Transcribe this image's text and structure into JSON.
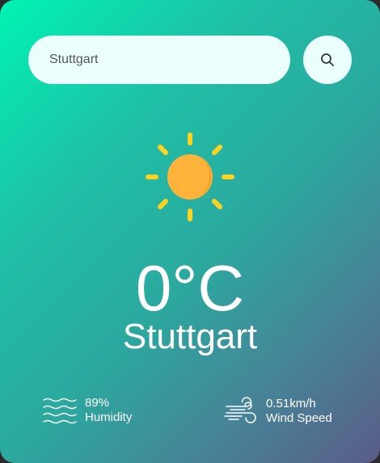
{
  "search": {
    "value": "Stuttgart",
    "placeholder": ""
  },
  "weather": {
    "icon": "sun-icon",
    "temperature": "0°C",
    "city": "Stuttgart"
  },
  "details": {
    "humidity": {
      "icon": "humidity-waves-icon",
      "value": "89%",
      "label": "Humidity"
    },
    "wind": {
      "icon": "wind-icon",
      "value": "0.51km/h",
      "label": "Wind Speed"
    }
  },
  "colors": {
    "gradient_start": "#00f3b4",
    "gradient_end": "#5a5c87",
    "search_bg": "#ebfffc",
    "sun_core": "#ffb33a",
    "sun_rays": "#ffd21f",
    "text": "#ffffff"
  }
}
